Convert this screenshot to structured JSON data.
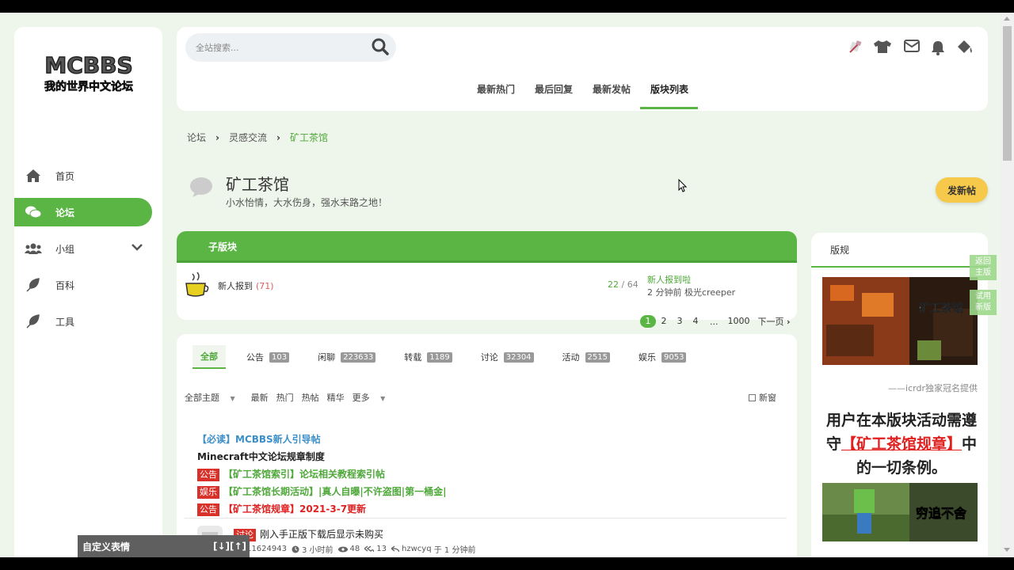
{
  "search": {
    "placeholder": "全站搜索..."
  },
  "logo": {
    "line1": "MCBBS",
    "line2": "我的世界中文论坛"
  },
  "sidebar": {
    "items": [
      {
        "label": "首页",
        "icon": "home-icon"
      },
      {
        "label": "论坛",
        "icon": "chat-icon"
      },
      {
        "label": "小组",
        "icon": "group-icon"
      },
      {
        "label": "百科",
        "icon": "feather-icon"
      },
      {
        "label": "工具",
        "icon": "feather-icon"
      }
    ]
  },
  "header": {
    "icons": [
      "pickaxe-icon",
      "shirt-icon",
      "mail-icon",
      "bell-icon",
      "paint-bucket-icon"
    ],
    "tabs": [
      {
        "label": "最新热门"
      },
      {
        "label": "最后回复"
      },
      {
        "label": "最新发帖"
      },
      {
        "label": "版块列表"
      }
    ]
  },
  "breadcrumb": {
    "items": [
      "论坛",
      "灵感交流",
      "矿工茶馆"
    ]
  },
  "forum": {
    "title": "矿工茶馆",
    "description": "小水怡情，大水伤身，强水末路之地！",
    "post_button": "发新帖"
  },
  "subforum": {
    "header": "子版块",
    "name": "新人报到",
    "count": "(71)",
    "stat_a": "22",
    "stat_sep": " / ",
    "stat_b": "64",
    "last_title": "新人报到啦",
    "last_meta": "2 分钟前 极光creeper"
  },
  "pager": {
    "pages": [
      "1",
      "2",
      "3",
      "4"
    ],
    "dots": "...",
    "last": "1000",
    "next": "下一页"
  },
  "type_tabs": [
    {
      "label": "全部",
      "count": null
    },
    {
      "label": "公告",
      "count": "103"
    },
    {
      "label": "闲聊",
      "count": "223633"
    },
    {
      "label": "转载",
      "count": "1189"
    },
    {
      "label": "讨论",
      "count": "32304"
    },
    {
      "label": "活动",
      "count": "2515"
    },
    {
      "label": "娱乐",
      "count": "9053"
    }
  ],
  "filters": {
    "all_topics": "全部主题",
    "latest": "最新",
    "hot": "热门",
    "hot_posts": "热帖",
    "digest": "精华",
    "more": "更多",
    "new_window": "新窗"
  },
  "sticky": [
    {
      "text": "【必读】MCBBS新人引导帖",
      "tag": null
    },
    {
      "text": "Minecraft中文论坛规章制度",
      "tag": null
    },
    {
      "text": "【矿工茶馆索引】论坛相关教程索引帖",
      "tag": "公告"
    },
    {
      "text": "【矿工茶馆长期活动】|真人自曝|不许盗图|第一桶金|",
      "tag": "娱乐"
    },
    {
      "text": "【矿工茶馆规章】2021-3-7更新",
      "tag": "公告"
    }
  ],
  "thread": {
    "tag": "讨论",
    "title": "刚入手正版下载后显示未购买",
    "author": "13611624943",
    "time": "3 小时前",
    "views": "48",
    "replies": "13",
    "last_user": "hzwcyq",
    "last_prefix": "于",
    "last_time": "1 分钟前"
  },
  "rules": {
    "header": "版规",
    "img1_text": "矿工茶馆",
    "credit": "——icrdr独家冠名提供",
    "text_1": "用户在本版块活动需遵守",
    "link": "【矿工茶馆规章】",
    "text_2": "中的一切条例。",
    "img2_text": "穷追不舍"
  },
  "float_buttons": [
    {
      "line1": "返回",
      "line2": "主版"
    },
    {
      "line1": "试用",
      "line2": "新版"
    }
  ],
  "emoji_bar": {
    "label": "自定义表情",
    "arrows": "[↓][↑]"
  },
  "colors": {
    "accent": "#5bb545",
    "post_button": "#f7c94a",
    "tag_red": "#d9302a",
    "link_blue": "#3b8fc9"
  }
}
